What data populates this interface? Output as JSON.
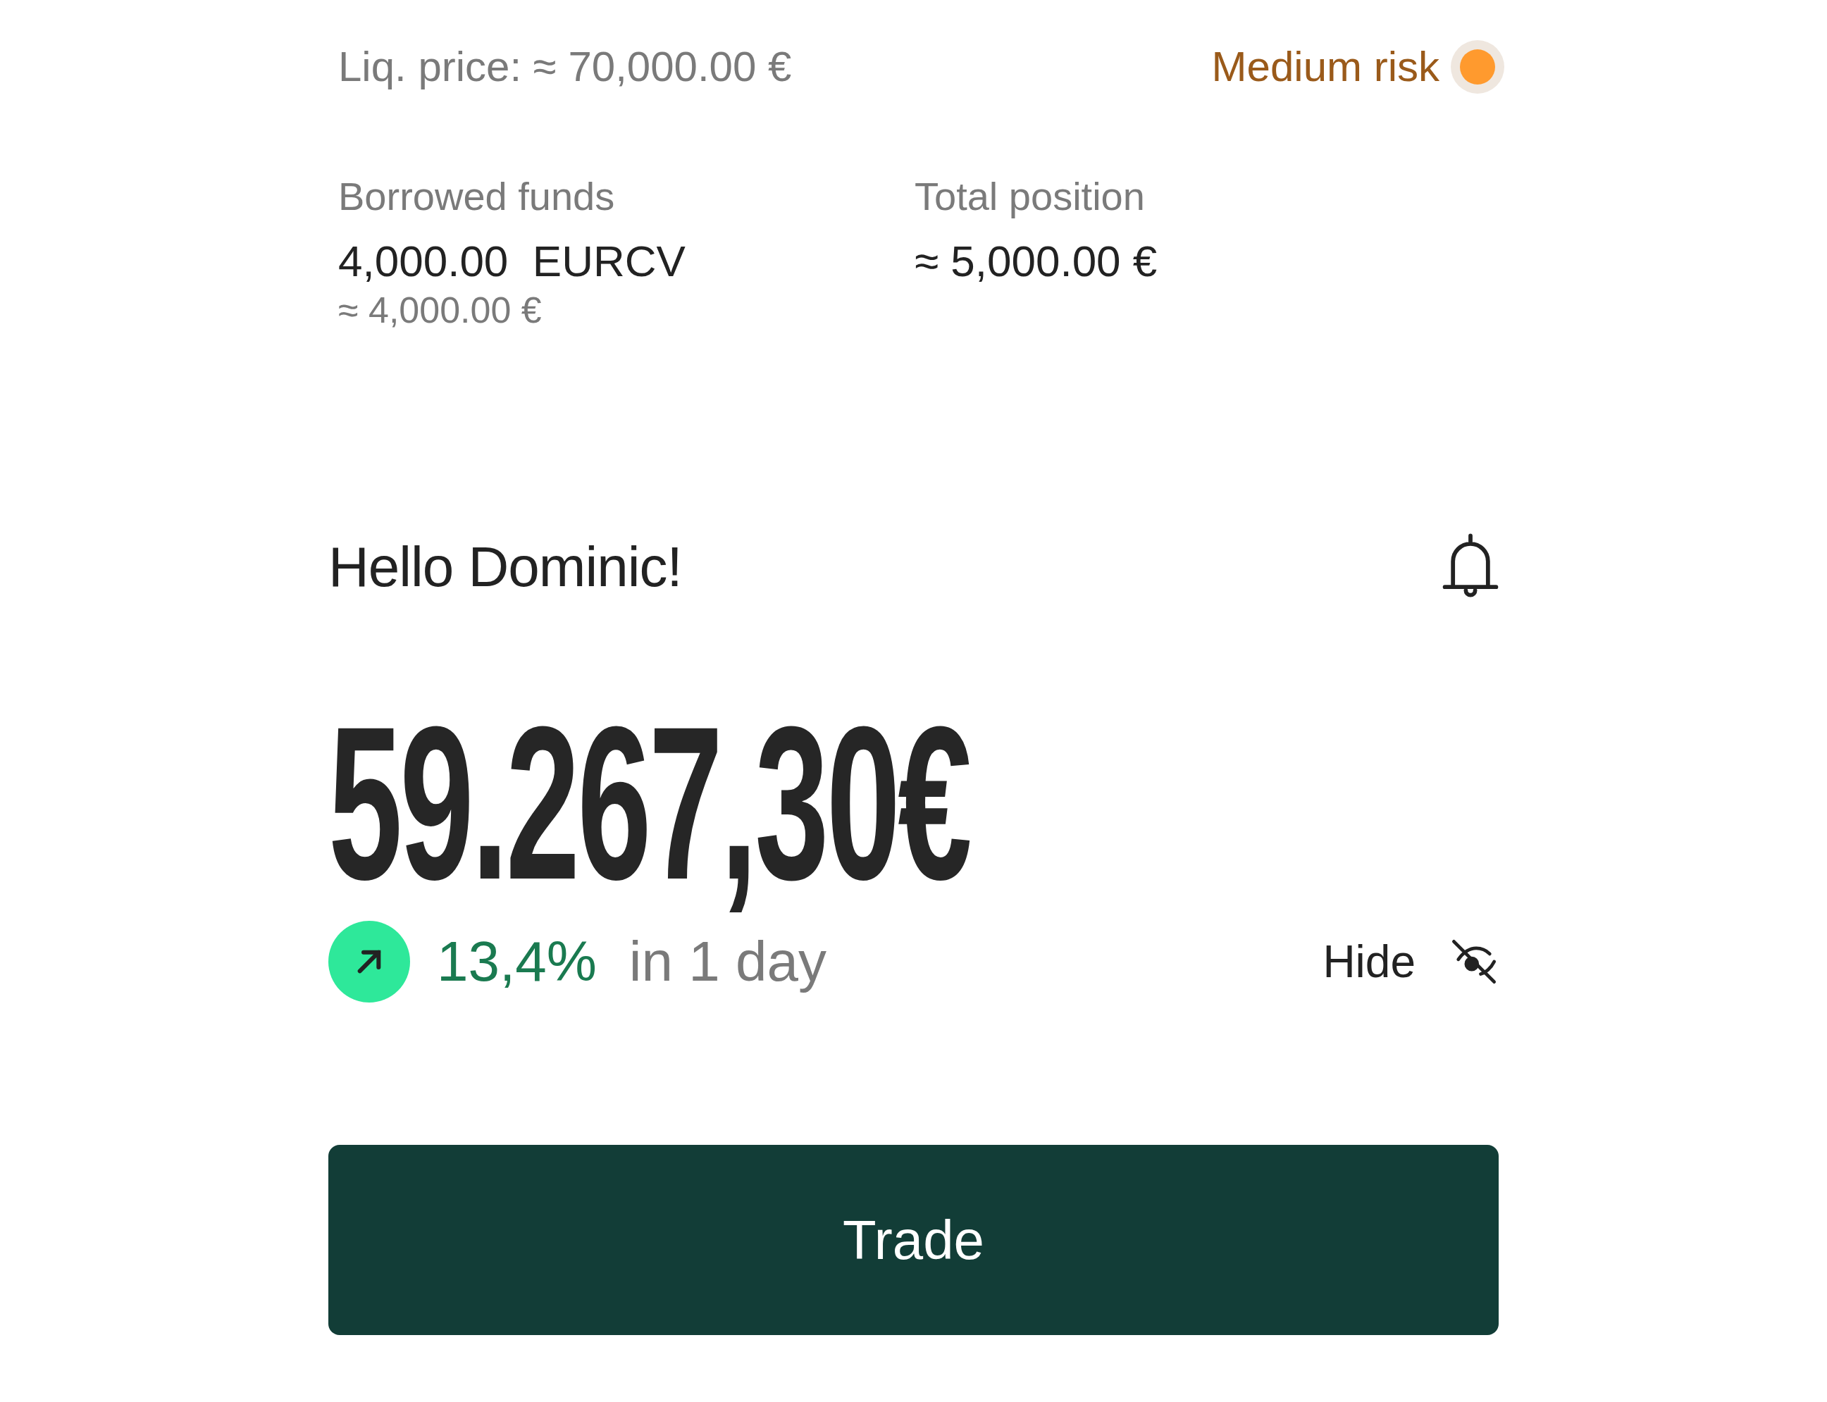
{
  "liquidation": {
    "label": "Liq. price: ≈ 70,000.00 €"
  },
  "risk": {
    "label": "Medium risk",
    "color": "#ff9a2e"
  },
  "stats": [
    {
      "label": "Borrowed funds",
      "value": "4,000.00  EURCV",
      "sub": "≈ 4,000.00 €"
    },
    {
      "label": "Total position",
      "value": "≈ 5,000.00 €"
    }
  ],
  "greeting": "Hello Dominic!",
  "balance": "59.267,30€",
  "change": {
    "rising": true,
    "percent": "13,4%",
    "period": "in 1 day"
  },
  "hide": {
    "label": "Hide"
  },
  "trade_button": "Trade"
}
